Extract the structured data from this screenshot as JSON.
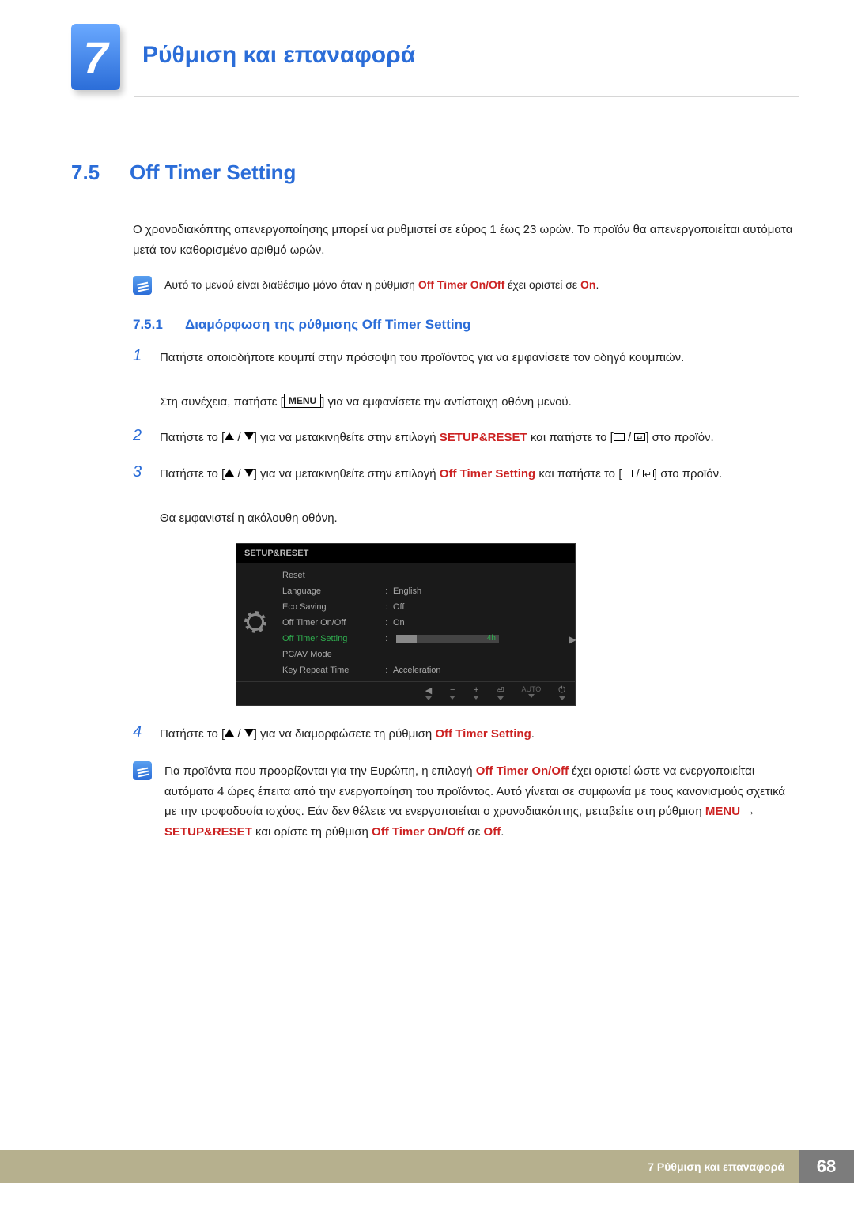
{
  "chapter": {
    "number": "7",
    "title": "Ρύθμιση και επαναφορά"
  },
  "section": {
    "number": "7.5",
    "title": "Off Timer Setting"
  },
  "intro": "Ο χρονοδιακόπτης απενεργοποίησης μπορεί να ρυθμιστεί σε εύρος 1 έως 23 ωρών. Το προϊόν θα απενεργοποιείται αυτόματα μετά τον καθορισμένο αριθμό ωρών.",
  "note1": {
    "pre": "Αυτό το μενού είναι διαθέσιμο μόνο όταν η ρύθμιση ",
    "kw1": "Off Timer On/Off",
    "mid": " έχει οριστεί σε ",
    "kw2": "On",
    "post": "."
  },
  "subsection": {
    "number": "7.5.1",
    "title": "Διαμόρφωση της ρύθμισης Off Timer Setting"
  },
  "steps": {
    "s1": {
      "num": "1",
      "p1": "Πατήστε οποιοδήποτε κουμπί στην πρόσοψη του προϊόντος για να εμφανίσετε τον οδηγό κουμπιών.",
      "p2a": "Στη συνέχεια, πατήστε [",
      "menu": "MENU",
      "p2b": "] για να εμφανίσετε την αντίστοιχη οθόνη μενού."
    },
    "s2": {
      "num": "2",
      "a": "Πατήστε το [",
      "b": "] για να μετακινηθείτε στην επιλογή ",
      "kw": "SETUP&RESET",
      "c": " και πατήστε το [",
      "d": "] στο προϊόν."
    },
    "s3": {
      "num": "3",
      "a": "Πατήστε το [",
      "b": "] για να μετακινηθείτε στην επιλογή ",
      "kw": "Off Timer Setting",
      "c": " και πατήστε το [",
      "d": "] στο προϊόν.",
      "e": "Θα εμφανιστεί η ακόλουθη οθόνη."
    },
    "s4": {
      "num": "4",
      "a": "Πατήστε το [",
      "b": "] για να διαμορφώσετε τη ρύθμιση ",
      "kw": "Off Timer Setting",
      "c": "."
    }
  },
  "osd": {
    "title": "SETUP&RESET",
    "rows": {
      "reset": "Reset",
      "language": "Language",
      "language_v": "English",
      "eco": "Eco Saving",
      "eco_v": "Off",
      "onoff": "Off Timer On/Off",
      "onoff_v": "On",
      "setting": "Off Timer Setting",
      "setting_v": "4h",
      "pcav": "PC/AV Mode",
      "repeat": "Key Repeat Time",
      "repeat_v": "Acceleration"
    },
    "footer_auto": "AUTO"
  },
  "note2": {
    "t1": "Για προϊόντα που προορίζονται για την Ευρώπη, η επιλογή ",
    "kw1": "Off Timer On/Off",
    "t2": " έχει οριστεί ώστε να ενεργοποιείται αυτόματα 4 ώρες έπειτα από την ενεργοποίηση του προϊόντος. Αυτό γίνεται σε συμφωνία με τους κανονισμούς σχετικά με την τροφοδοσία ισχύος. Εάν δεν θέλετε να ενεργοποιείται ο χρονοδιακόπτης, μεταβείτε στη ρύθμιση ",
    "kw2": "MENU",
    "arrow": " → ",
    "kw3": "SETUP&RESET",
    "t3": " και ορίστε τη ρύθμιση ",
    "kw4": "Off Timer On/Off",
    "t4": " σε ",
    "kw5": "Off",
    "t5": "."
  },
  "footer": {
    "text": "7 Ρύθμιση και επαναφορά",
    "page": "68"
  }
}
